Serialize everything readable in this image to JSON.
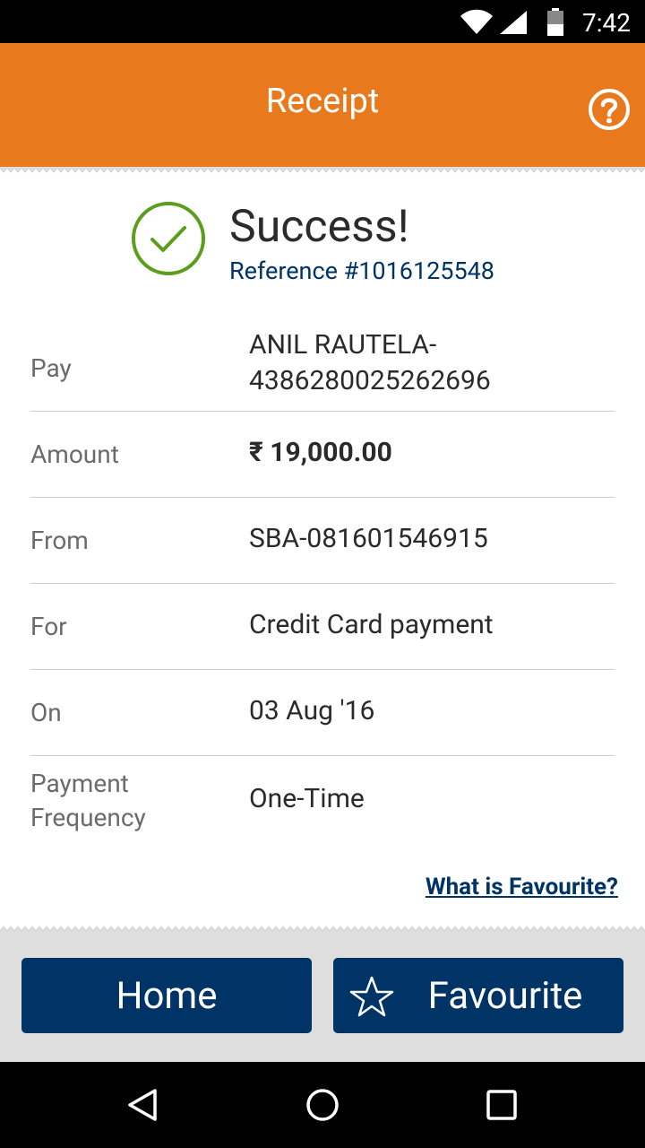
{
  "status_bar": {
    "time": "7:42"
  },
  "app_bar": {
    "title": "Receipt",
    "help_icon": "help-icon"
  },
  "result": {
    "title": "Success!",
    "reference": "Reference #1016125548"
  },
  "details": [
    {
      "label": "Pay",
      "value": "ANIL RAUTELA-\n4386280025262696"
    },
    {
      "label": "Amount",
      "value": "₹ 19,000.00"
    },
    {
      "label": "From",
      "value": "SBA-081601546915"
    },
    {
      "label": "For",
      "value": "Credit Card payment"
    },
    {
      "label": "On",
      "value": "03 Aug '16"
    },
    {
      "label": "Payment\nFrequency",
      "value": "One-Time"
    }
  ],
  "favourite_link": "What is Favourite?",
  "buttons": {
    "home": "Home",
    "favourite": "Favourite"
  },
  "colors": {
    "app_bar": "#E8791C",
    "primary": "#003366",
    "success": "#5A9E1B",
    "bottom_area": "#dedede"
  }
}
